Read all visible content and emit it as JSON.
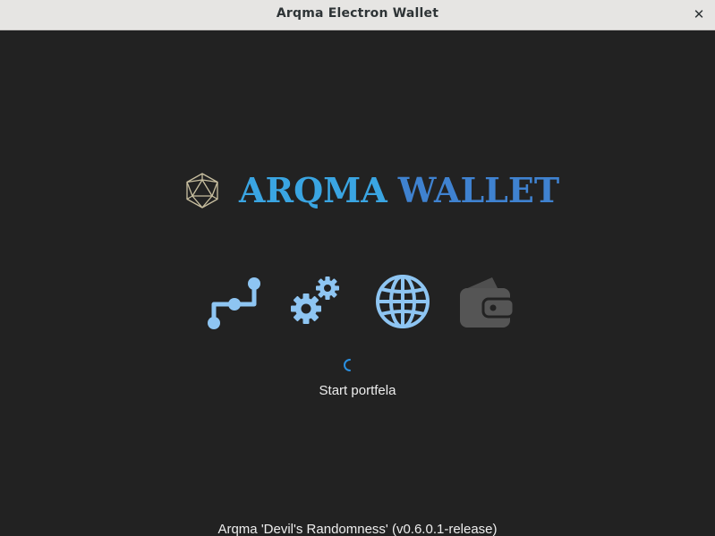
{
  "window": {
    "title": "Arqma Electron Wallet",
    "close_glyph": "✕"
  },
  "logo": {
    "icon": "icosahedron-logo-icon",
    "word1": "ARQMA",
    "word2": "WALLET"
  },
  "steps": [
    {
      "icon": "network-nodes-icon",
      "state": "active",
      "color": "#8ec5f2"
    },
    {
      "icon": "gears-icon",
      "state": "active",
      "color": "#8ec5f2"
    },
    {
      "icon": "globe-icon",
      "state": "active",
      "color": "#8ec5f2"
    },
    {
      "icon": "wallet-icon",
      "state": "inactive",
      "color": "#555555"
    }
  ],
  "status": {
    "text": "Start portfela",
    "spinner_color": "#2a8fe0"
  },
  "footer": {
    "version": "Arqma 'Devil's Randomness' (v0.6.0.1-release)"
  },
  "colors": {
    "background": "#222222",
    "titlebar": "#e6e5e3",
    "accent_light": "#3aa5e2",
    "accent_dark": "#3f82d0"
  }
}
